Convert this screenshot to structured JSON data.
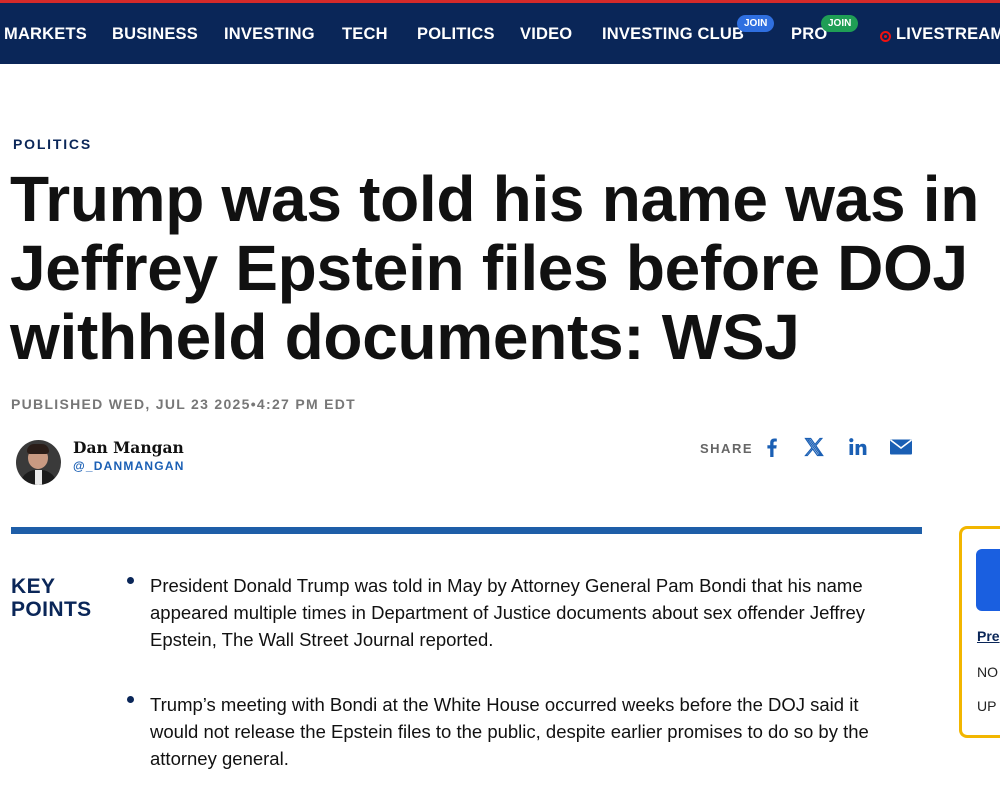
{
  "nav": {
    "items": [
      "MARKETS",
      "BUSINESS",
      "INVESTING",
      "TECH",
      "POLITICS",
      "VIDEO",
      "INVESTING CLUB",
      "PRO",
      "LIVESTREAM"
    ],
    "join_badge": "JOIN",
    "colors": {
      "background": "#0a2658",
      "accent_red": "#d42a2a"
    }
  },
  "article": {
    "section": "POLITICS",
    "headline_lines": [
      "Trump was told his name was in",
      "Jeffrey Epstein files before DOJ",
      "withheld documents: WSJ"
    ],
    "published": "PUBLISHED WED, JUL 23 2025•4:27 PM EDT",
    "author": {
      "name": "Dan Mangan",
      "handle": "@_DANMANGAN"
    },
    "share": {
      "label": "SHARE",
      "icons": [
        "facebook-icon",
        "x-icon",
        "linkedin-icon",
        "email-icon"
      ]
    }
  },
  "key_points": {
    "title_line1": "KEY",
    "title_line2": "POINTS",
    "items": [
      "President Donald Trump was told in May by Attorney General Pam Bondi that his name appeared multiple times in Department of Justice documents about sex offender Jeffrey Epstein, The Wall Street Journal reported.",
      "Trump’s meeting with Bondi at the White House occurred weeks before the DOJ said it would not release the Epstein files to the public, despite earlier promises to do so by the attorney general."
    ]
  },
  "side_card": {
    "link": "Pre",
    "line1": "NO",
    "line2": "UP"
  }
}
